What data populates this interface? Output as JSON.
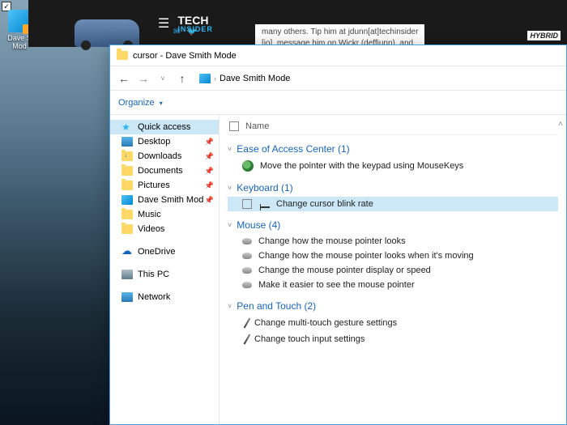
{
  "desktop": {
    "icon_label": "Dave S\nMod"
  },
  "browser": {
    "logo_top": "TECH",
    "logo_bottom": "INSIDER",
    "article_snippet": "many others. Tip him at jdunn[at]techinsider\n[io], message him on Wickr (deffjunn), and",
    "hybrid_text": "HYBRID",
    "social": "✉ 🐦"
  },
  "explorer": {
    "title": "cursor - Dave Smith Mode",
    "breadcrumb": "Dave Smith Mode",
    "organize": "Organize",
    "column_name": "Name",
    "sidebar": {
      "quick_access": "Quick access",
      "desktop": "Desktop",
      "downloads": "Downloads",
      "documents": "Documents",
      "pictures": "Pictures",
      "dsm": "Dave Smith Mod",
      "music": "Music",
      "videos": "Videos",
      "onedrive": "OneDrive",
      "this_pc": "This PC",
      "network": "Network"
    },
    "groups": [
      {
        "name": "Ease of Access Center",
        "count": 1,
        "items": [
          {
            "icon": "keypad",
            "label": "Move the pointer with the keypad using MouseKeys",
            "selected": false
          }
        ]
      },
      {
        "name": "Keyboard",
        "count": 1,
        "items": [
          {
            "icon": "cursor",
            "label": "Change cursor blink rate",
            "selected": true
          }
        ]
      },
      {
        "name": "Mouse",
        "count": 4,
        "items": [
          {
            "icon": "mouse",
            "label": "Change how the mouse pointer looks"
          },
          {
            "icon": "mouse",
            "label": "Change how the mouse pointer looks when it's moving"
          },
          {
            "icon": "mouse",
            "label": "Change the mouse pointer display or speed"
          },
          {
            "icon": "mouse",
            "label": "Make it easier to see the mouse pointer"
          }
        ]
      },
      {
        "name": "Pen and Touch",
        "count": 2,
        "items": [
          {
            "icon": "pen",
            "label": "Change multi-touch gesture settings"
          },
          {
            "icon": "pen",
            "label": "Change touch input settings"
          }
        ]
      }
    ]
  }
}
